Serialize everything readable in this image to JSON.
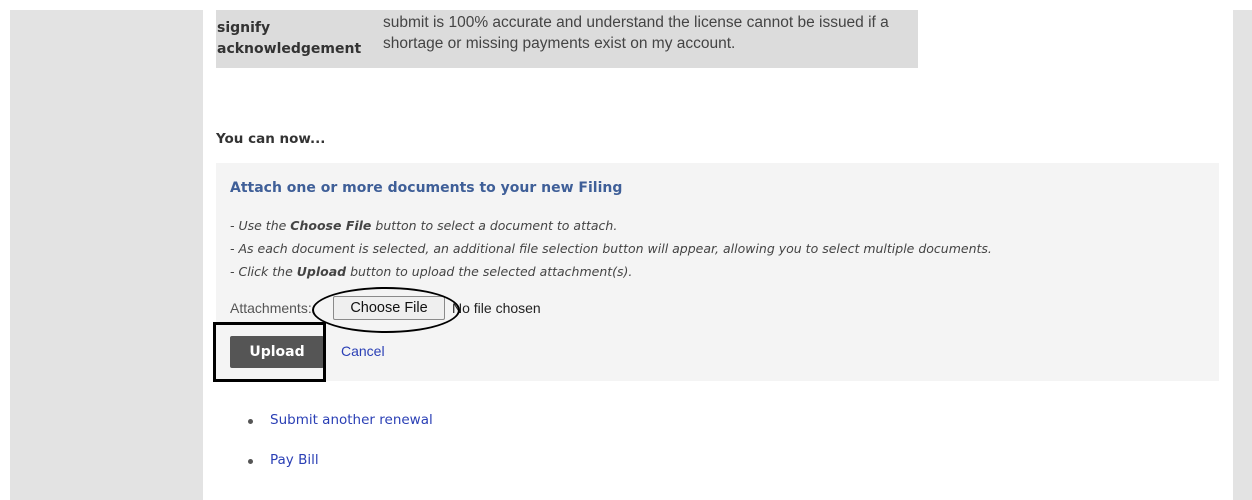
{
  "acknowledgement": {
    "label_cut": "signify",
    "label_lines": [
      "signify",
      "acknowledgement"
    ],
    "text": "submit is 100% accurate and understand the license cannot be issued if a shortage or missing payments exist on my account."
  },
  "next_steps": {
    "heading": "You can now..."
  },
  "attach_panel": {
    "title": "Attach one or more documents to your new Filing",
    "hints": [
      {
        "pre": "- Use the ",
        "bold": "Choose File",
        "post": " button to select a document to attach."
      },
      {
        "pre": "- As each document is selected, an additional file selection button will appear, allowing you to select multiple documents.",
        "bold": "",
        "post": ""
      },
      {
        "pre": "- Click the ",
        "bold": "Upload",
        "post": " button to upload the selected attachment(s)."
      }
    ],
    "attachments_label": "Attachments:",
    "choose_file_label": "Choose File",
    "file_status": "No file chosen",
    "upload_label": "Upload",
    "cancel_label": "Cancel"
  },
  "links": [
    {
      "label": "Submit another renewal"
    },
    {
      "label": "Pay Bill"
    }
  ],
  "colors": {
    "panel_title": "#3f5f98",
    "link": "#2a3fb5",
    "upload_button_bg": "#555555",
    "annotation": "#000000"
  }
}
